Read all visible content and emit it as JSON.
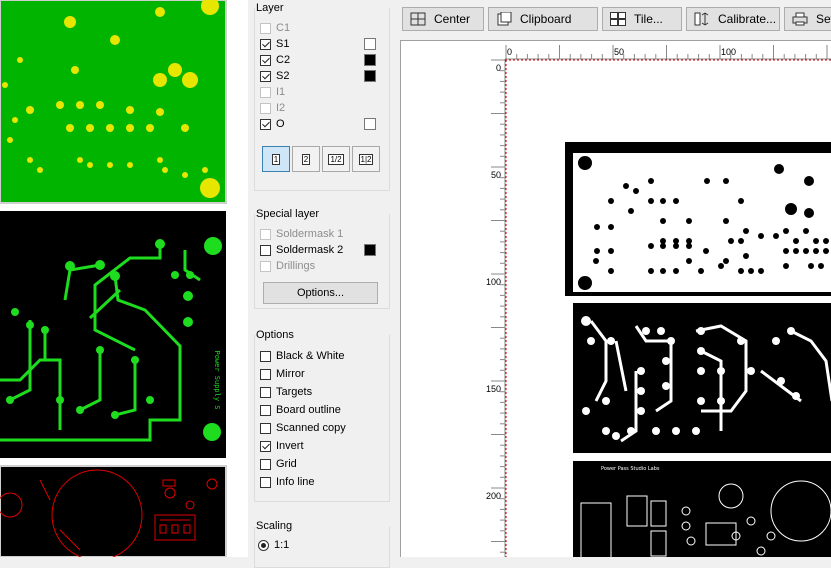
{
  "layer_panel": {
    "title": "Layer",
    "layers": [
      {
        "label": "C1",
        "checked": false,
        "enabled": false,
        "swatch": null
      },
      {
        "label": "S1",
        "checked": true,
        "enabled": true,
        "swatch": "#ffffff"
      },
      {
        "label": "C2",
        "checked": true,
        "enabled": true,
        "swatch": "#000000"
      },
      {
        "label": "S2",
        "checked": true,
        "enabled": true,
        "swatch": "#000000"
      },
      {
        "label": "I1",
        "checked": false,
        "enabled": false,
        "swatch": null
      },
      {
        "label": "I2",
        "checked": false,
        "enabled": false,
        "swatch": null
      },
      {
        "label": "O",
        "checked": true,
        "enabled": true,
        "swatch": "#ffffff"
      }
    ],
    "page_buttons": [
      "1",
      "2",
      "1/2",
      "1|2"
    ]
  },
  "special_layer": {
    "title": "Special layer",
    "items": [
      {
        "label": "Soldermask 1",
        "checked": false,
        "enabled": false,
        "swatch": null
      },
      {
        "label": "Soldermask 2",
        "checked": false,
        "enabled": true,
        "swatch": "#000000"
      },
      {
        "label": "Drillings",
        "checked": false,
        "enabled": false,
        "swatch": null
      }
    ],
    "options_button": "Options..."
  },
  "options": {
    "title": "Options",
    "items": [
      {
        "label": "Black & White",
        "checked": false
      },
      {
        "label": "Mirror",
        "checked": false
      },
      {
        "label": "Targets",
        "checked": false
      },
      {
        "label": "Board outline",
        "checked": false
      },
      {
        "label": "Scanned copy",
        "checked": false
      },
      {
        "label": "Invert",
        "checked": true
      },
      {
        "label": "Grid",
        "checked": false
      },
      {
        "label": "Info line",
        "checked": false
      }
    ]
  },
  "scaling": {
    "title": "Scaling",
    "selected": "1:1"
  },
  "toolbar": {
    "center": "Center",
    "clipboard": "Clipboard",
    "tile": "Tile...",
    "calibrate": "Calibrate...",
    "setup": "Setup"
  },
  "ruler": {
    "top_ticks": [
      "0",
      "50",
      "100"
    ],
    "left_ticks": [
      "0",
      "50",
      "100",
      "150",
      "200"
    ]
  },
  "silkscreen_text": {
    "green_board": "Power Supply S",
    "print_board": "Power Pass Studio Labs"
  },
  "colors": {
    "green_board": "#00b400",
    "board_green_pads": "#e6e600",
    "trace_green": "#1edc1e",
    "red_silkscreen": "#e00000",
    "selection_blue": "#3c7fb1"
  }
}
